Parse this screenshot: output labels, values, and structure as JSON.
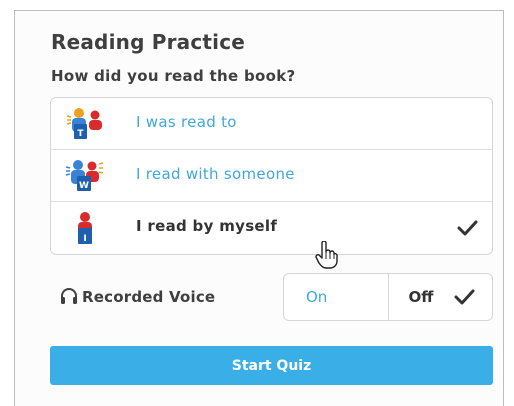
{
  "panel": {
    "title": "Reading Practice",
    "question": "How did you read the book?"
  },
  "options": [
    {
      "label": "I was read to",
      "icon": "read-to-icon",
      "badge": "T",
      "selected": false
    },
    {
      "label": "I read with someone",
      "icon": "read-with-someone-icon",
      "badge": "W",
      "selected": false
    },
    {
      "label": "I read by myself",
      "icon": "read-by-myself-icon",
      "badge": "I",
      "selected": true
    }
  ],
  "recorded_voice": {
    "label": "Recorded Voice",
    "icon": "headphones-icon",
    "on_label": "On",
    "off_label": "Off",
    "selected": "Off"
  },
  "start_button": {
    "label": "Start Quiz"
  },
  "colors": {
    "accent": "#3aaee6",
    "link_text": "#3fa9d9",
    "dark_text": "#3f3f3f",
    "badge_blue": "#1f5fb0",
    "person_red": "#d92b2b",
    "person_blue": "#3a82d6",
    "person_orange": "#f0a020"
  }
}
